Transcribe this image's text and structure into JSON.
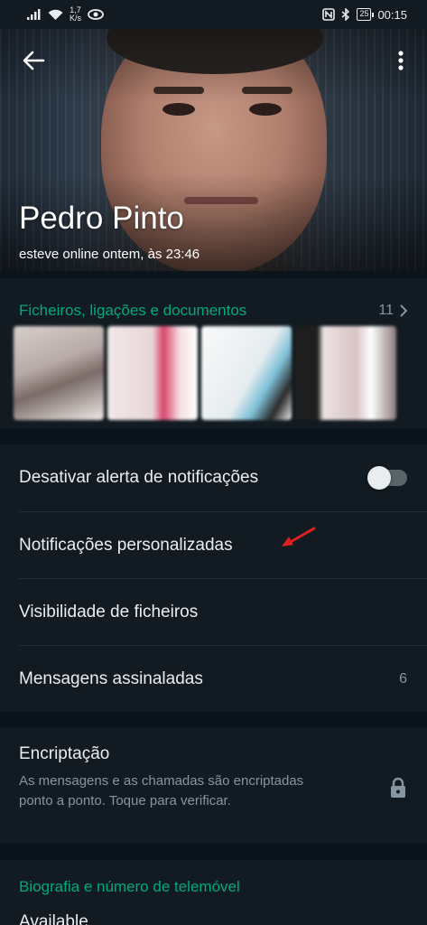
{
  "status_bar": {
    "speed_value": "1,7",
    "speed_unit": "K/s",
    "battery": "25",
    "time": "00:15"
  },
  "header": {
    "contact_name": "Pedro Pinto",
    "last_seen": "esteve online ontem, às 23:46"
  },
  "media": {
    "title": "Ficheiros, ligações e documentos",
    "count": "11"
  },
  "settings": {
    "mute_notifications_label": "Desativar alerta de notificações",
    "mute_notifications_enabled": false,
    "custom_notifications_label": "Notificações personalizadas",
    "media_visibility_label": "Visibilidade de ficheiros",
    "starred_messages_label": "Mensagens assinaladas",
    "starred_messages_count": "6"
  },
  "encryption": {
    "title": "Encriptação",
    "description": "As mensagens e as chamadas são encriptadas ponto a ponto. Toque para verificar."
  },
  "about": {
    "title": "Biografia e número de telemóvel",
    "text": "Available"
  },
  "colors": {
    "accent": "#00a884",
    "background": "#0b141a",
    "surface": "#111b21",
    "secondary_text": "#8696a0",
    "annotation_arrow": "#e02020"
  },
  "icons": [
    "back-arrow-icon",
    "more-options-icon",
    "chevron-right-icon",
    "lock-icon",
    "signal-icon",
    "wifi-icon",
    "eye-icon",
    "nfc-icon",
    "bluetooth-icon",
    "battery-icon"
  ]
}
